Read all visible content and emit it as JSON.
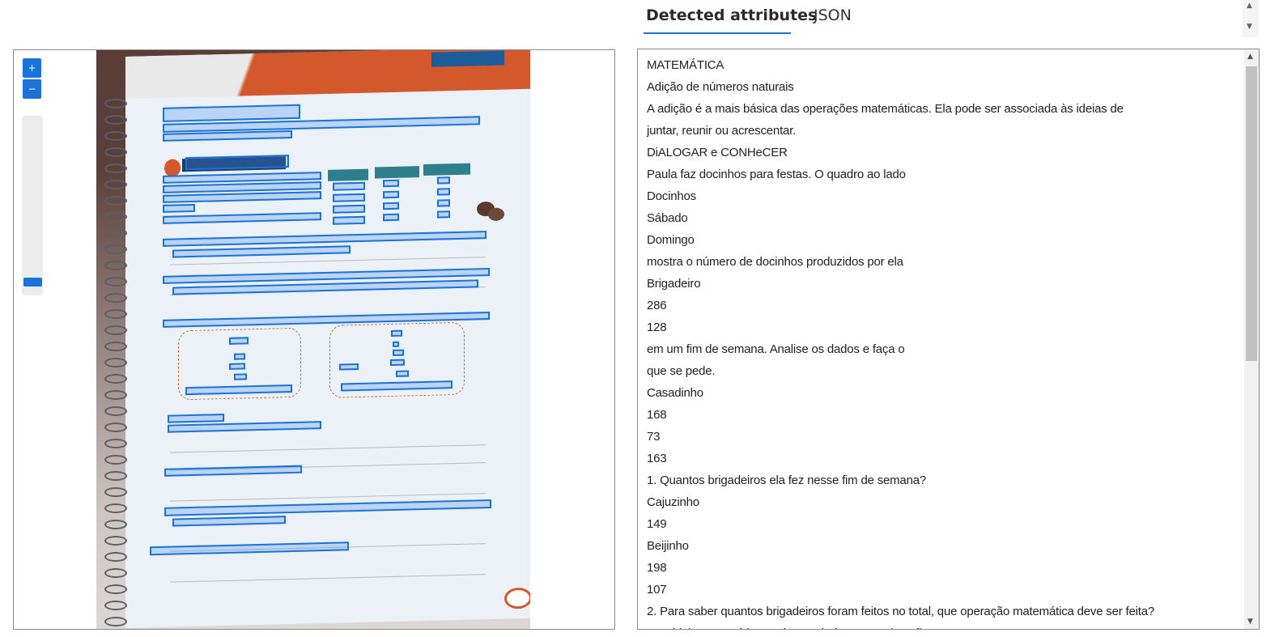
{
  "tabs": [
    {
      "label": "Detected attributes",
      "active": true
    },
    {
      "label": "JSON",
      "active": false
    }
  ],
  "viewer": {
    "zoom_in_icon": "plus-icon",
    "zoom_out_icon": "minus-icon",
    "accent_color": "#1a73d9"
  },
  "detected_lines": [
    "MATEMÁTICA",
    "Adição de números naturais",
    "A adição é a mais básica das operações matemáticas. Ela pode ser associada às ideias de",
    "juntar, reunir ou acrescentar.",
    "DiALOGAR e CONHeCER",
    "Paula faz docinhos para festas. O quadro ao lado",
    "Docinhos",
    "Sábado",
    "Domingo",
    "mostra o número de docinhos produzidos por ela",
    "Brigadeiro",
    "286",
    "128",
    "em um fim de semana. Analise os dados e faça o",
    "que se pede.",
    "Casadinho",
    "168",
    "73",
    "163",
    "1. Quantos brigadeiros ela fez nesse fim de semana?",
    "Cajuzinho",
    "149",
    "Beijinho",
    "198",
    "107",
    "2. Para saber quantos brigadeiros foram feitos no total, que operação matemática deve ser feita?",
    "Que ideia matemática está associada a essa situação?"
  ]
}
